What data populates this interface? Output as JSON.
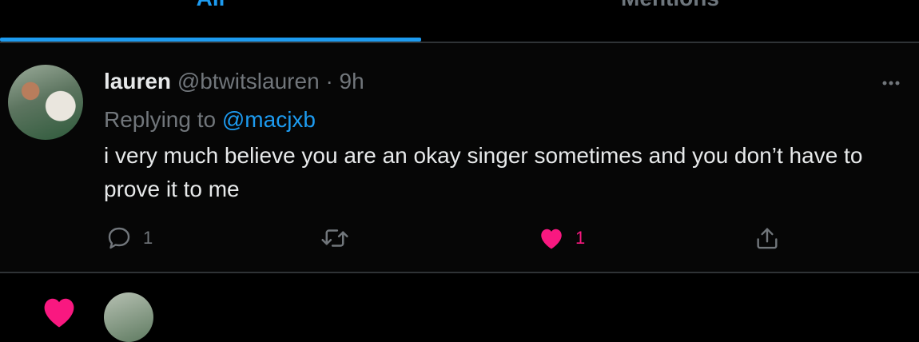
{
  "tabs": {
    "all_label": "All",
    "mentions_label": "Mentions",
    "active": "All"
  },
  "tweet": {
    "display_name": "lauren",
    "handle": "@btwitslauren",
    "separator": "·",
    "time": "9h",
    "replying_prefix": "Replying to",
    "replying_to": "@macjxb",
    "text": "i very much believe you are an okay singer sometimes and you don’t have to prove it to me",
    "reply_count": "1",
    "like_count": "1",
    "liked": true,
    "more_icon": "more-horizontal-icon"
  },
  "colors": {
    "background": "#000000",
    "accent": "#1d9bf0",
    "like": "#f91880",
    "muted": "#71767b",
    "text": "#e7e9ea"
  }
}
